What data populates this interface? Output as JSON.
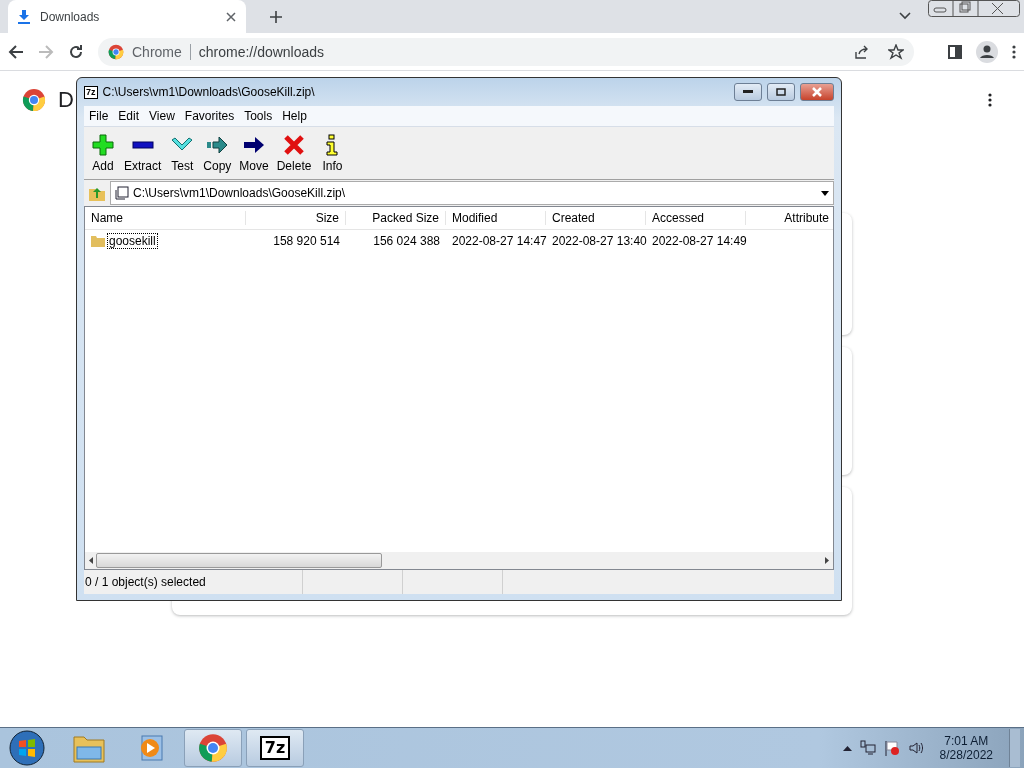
{
  "browser": {
    "tabs": [
      {
        "title": "Downloads",
        "selected": true
      }
    ],
    "omnibox": {
      "site": "Chrome",
      "url": "chrome://downloads"
    },
    "page": {
      "heading": "D"
    }
  },
  "archiver": {
    "logo": "7z",
    "title": "C:\\Users\\vm1\\Downloads\\GooseKill.zip\\",
    "menu": [
      "File",
      "Edit",
      "View",
      "Favorites",
      "Tools",
      "Help"
    ],
    "toolbar": [
      {
        "label": "Add",
        "kind": "add"
      },
      {
        "label": "Extract",
        "kind": "extract"
      },
      {
        "label": "Test",
        "kind": "test"
      },
      {
        "label": "Copy",
        "kind": "copy"
      },
      {
        "label": "Move",
        "kind": "move"
      },
      {
        "label": "Delete",
        "kind": "delete"
      },
      {
        "label": "Info",
        "kind": "info"
      }
    ],
    "path": "C:\\Users\\vm1\\Downloads\\GooseKill.zip\\",
    "columns": [
      "Name",
      "Size",
      "Packed Size",
      "Modified",
      "Created",
      "Accessed",
      "Attribute"
    ],
    "rows": [
      {
        "cells": [
          "goosekill",
          "158 920 514",
          "156 024 388",
          "2022-08-27 14:47",
          "2022-08-27 13:40",
          "2022-08-27 14:49"
        ],
        "selected": false
      }
    ],
    "status": "0 / 1 object(s) selected"
  },
  "taskbar": {
    "apps": [
      {
        "kind": "explorer",
        "active": false
      },
      {
        "kind": "media",
        "active": false
      },
      {
        "kind": "chrome",
        "active": true
      },
      {
        "kind": "sevenzip",
        "active": true,
        "label": "7z"
      }
    ],
    "time": "7:01 AM",
    "date": "8/28/2022"
  }
}
